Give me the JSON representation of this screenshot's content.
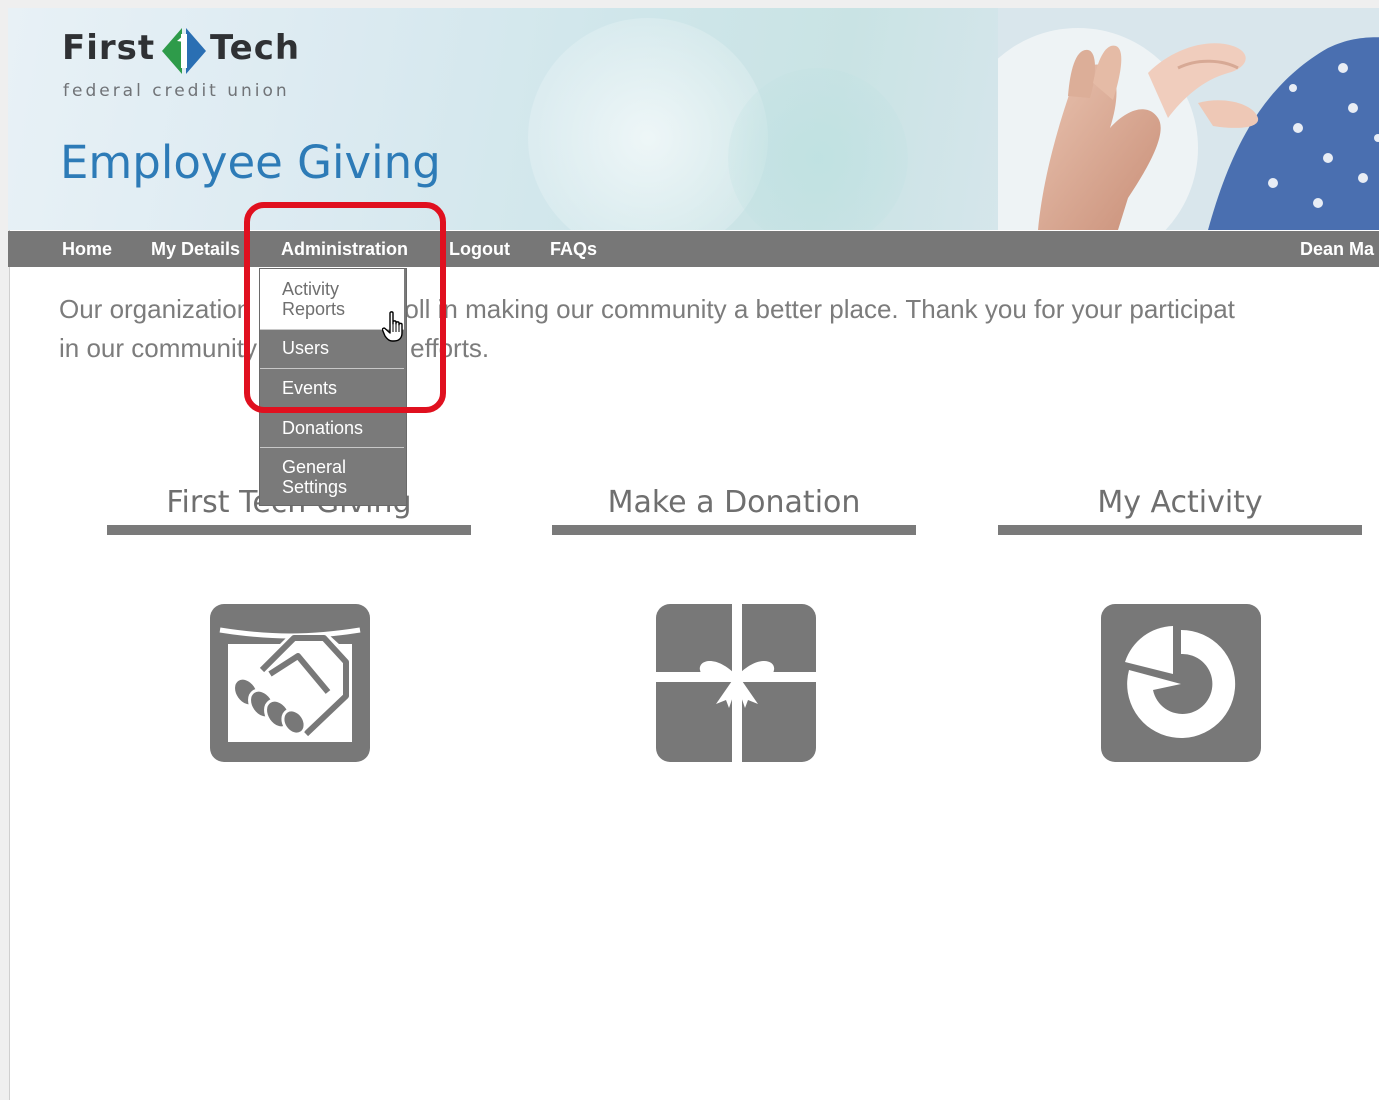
{
  "header": {
    "logo_first": "First",
    "logo_tech": "Tech",
    "logo_sub": "federal credit union",
    "title": "Employee Giving"
  },
  "nav": {
    "items": [
      {
        "label": "Home"
      },
      {
        "label": "My Details"
      },
      {
        "label": "Administration"
      },
      {
        "label": "Logout"
      },
      {
        "label": "FAQs"
      }
    ],
    "user": "Dean Ma"
  },
  "admin_menu": {
    "items": [
      {
        "label": "Activity Reports",
        "hovered": true
      },
      {
        "label": "Users"
      },
      {
        "label": "Events"
      },
      {
        "label": "Donations"
      },
      {
        "label": "General Settings"
      }
    ]
  },
  "intro": {
    "line1": "Our organization is playing a roll in making our community a better place. Thank you for your participat",
    "line2": "in our community involvement efforts."
  },
  "columns": [
    {
      "title": "First Tech Giving",
      "icon": "handshake-icon"
    },
    {
      "title": "Make a Donation",
      "icon": "gift-icon"
    },
    {
      "title": "My Activity",
      "icon": "pie-chart-icon"
    }
  ],
  "colors": {
    "nav_bg": "#777777",
    "title_blue": "#2d7bb7",
    "highlight_red": "#e0101f",
    "logo_green": "#2e9b4a"
  }
}
